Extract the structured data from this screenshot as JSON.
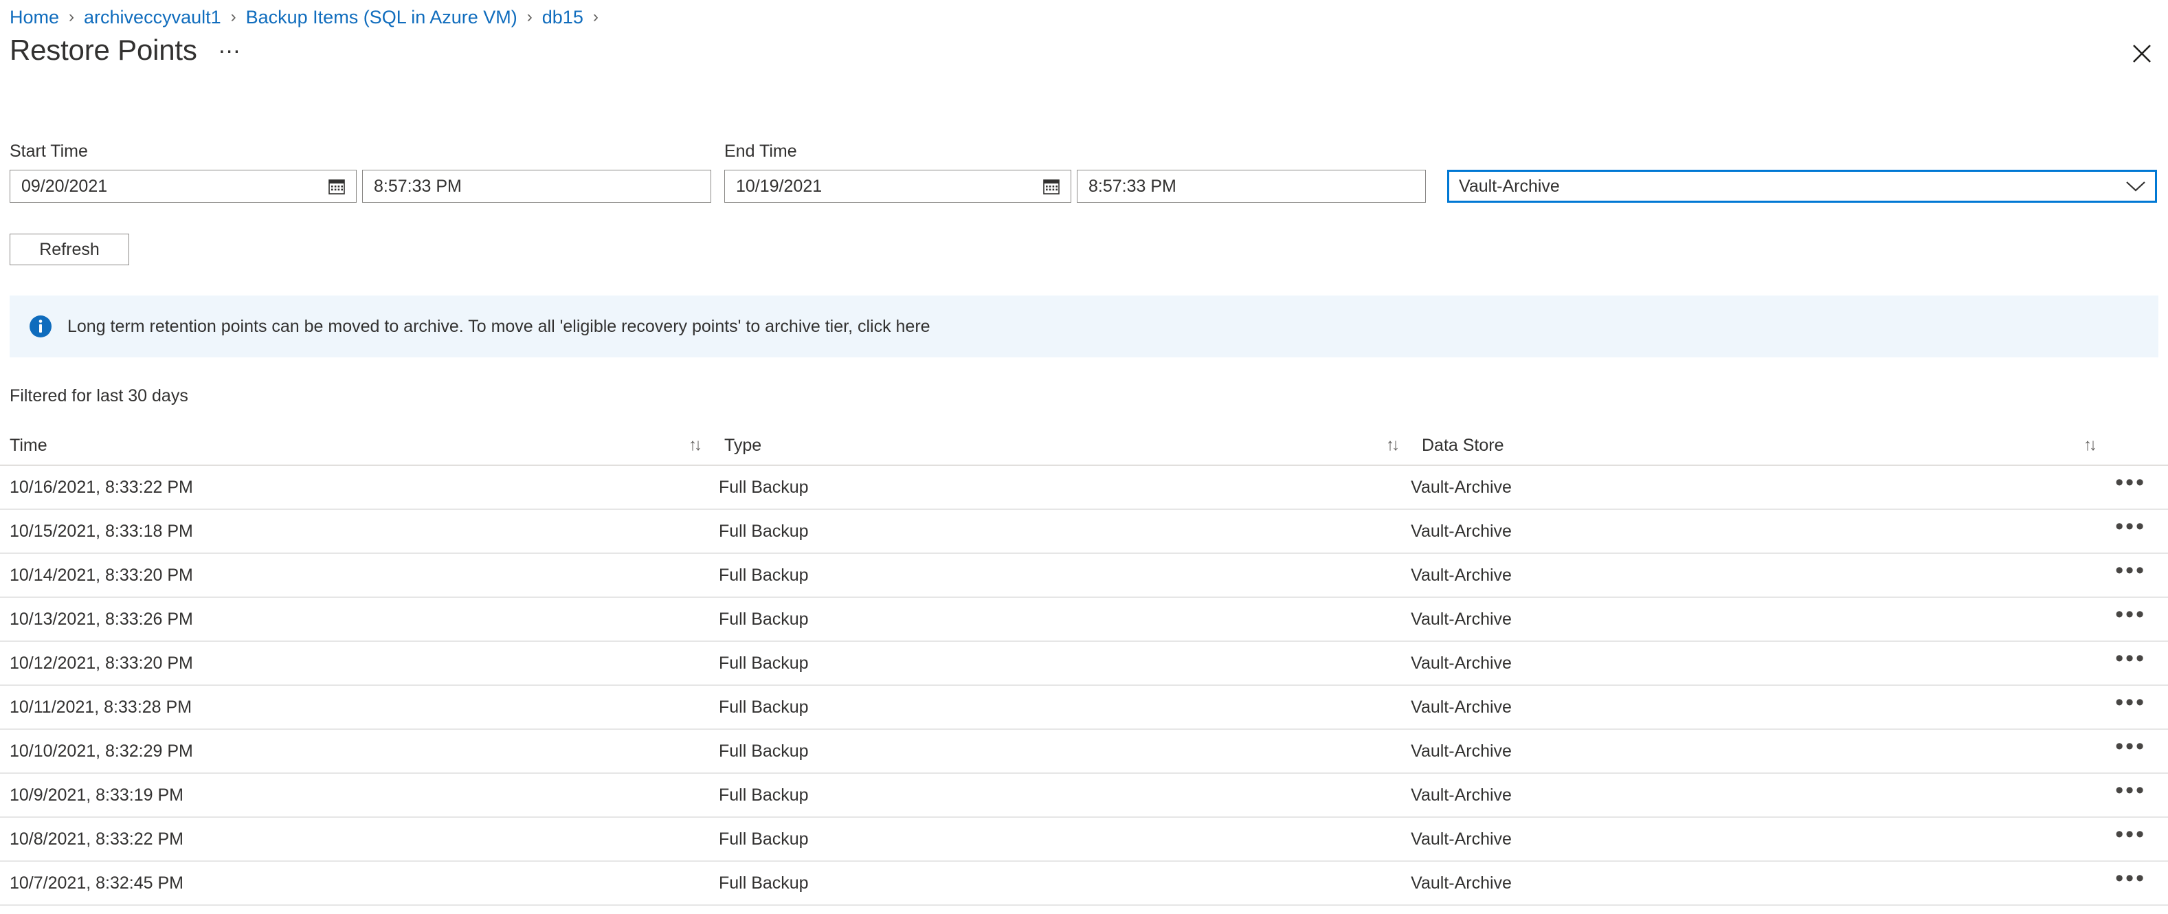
{
  "breadcrumb": {
    "separator": "›",
    "items": [
      {
        "label": "Home"
      },
      {
        "label": "archiveccyvault1"
      },
      {
        "label": "Backup Items (SQL in Azure VM)"
      },
      {
        "label": "db15"
      }
    ]
  },
  "header": {
    "title": "Restore Points",
    "more_label": "…",
    "close_icon": "close-icon"
  },
  "filters": {
    "start_time_label": "Start Time",
    "end_time_label": "End Time",
    "start_date_value": "09/20/2021",
    "start_time_value": "8:57:33 PM",
    "end_date_value": "10/19/2021",
    "end_time_value": "8:57:33 PM",
    "data_store_value": "Vault-Archive",
    "data_store_options": [
      "Vault-Archive"
    ],
    "calendar_icon": "calendar-icon",
    "chevron_icon": "chevron-down-icon",
    "focus_color": "#0078d4"
  },
  "toolbar": {
    "refresh_label": "Refresh"
  },
  "info_banner": {
    "icon": "info-icon",
    "icon_color": "#0f6cbd",
    "background": "#eff6fc",
    "message": "Long term retention points can be moved to archive. To move all 'eligible recovery points' to archive tier, click here"
  },
  "filter_note": "Filtered for last 30 days",
  "table": {
    "columns": [
      {
        "label": "Time",
        "sort_icon": "↑↓"
      },
      {
        "label": "Type",
        "sort_icon": "↑↓"
      },
      {
        "label": "Data Store",
        "sort_icon": "↑↓"
      }
    ],
    "row_menu_label": "•••",
    "rows": [
      {
        "time": "10/16/2021, 8:33:22 PM",
        "type": "Full Backup",
        "store": "Vault-Archive"
      },
      {
        "time": "10/15/2021, 8:33:18 PM",
        "type": "Full Backup",
        "store": "Vault-Archive"
      },
      {
        "time": "10/14/2021, 8:33:20 PM",
        "type": "Full Backup",
        "store": "Vault-Archive"
      },
      {
        "time": "10/13/2021, 8:33:26 PM",
        "type": "Full Backup",
        "store": "Vault-Archive"
      },
      {
        "time": "10/12/2021, 8:33:20 PM",
        "type": "Full Backup",
        "store": "Vault-Archive"
      },
      {
        "time": "10/11/2021, 8:33:28 PM",
        "type": "Full Backup",
        "store": "Vault-Archive"
      },
      {
        "time": "10/10/2021, 8:32:29 PM",
        "type": "Full Backup",
        "store": "Vault-Archive"
      },
      {
        "time": "10/9/2021, 8:33:19 PM",
        "type": "Full Backup",
        "store": "Vault-Archive"
      },
      {
        "time": "10/8/2021, 8:33:22 PM",
        "type": "Full Backup",
        "store": "Vault-Archive"
      },
      {
        "time": "10/7/2021, 8:32:45 PM",
        "type": "Full Backup",
        "store": "Vault-Archive"
      }
    ]
  }
}
